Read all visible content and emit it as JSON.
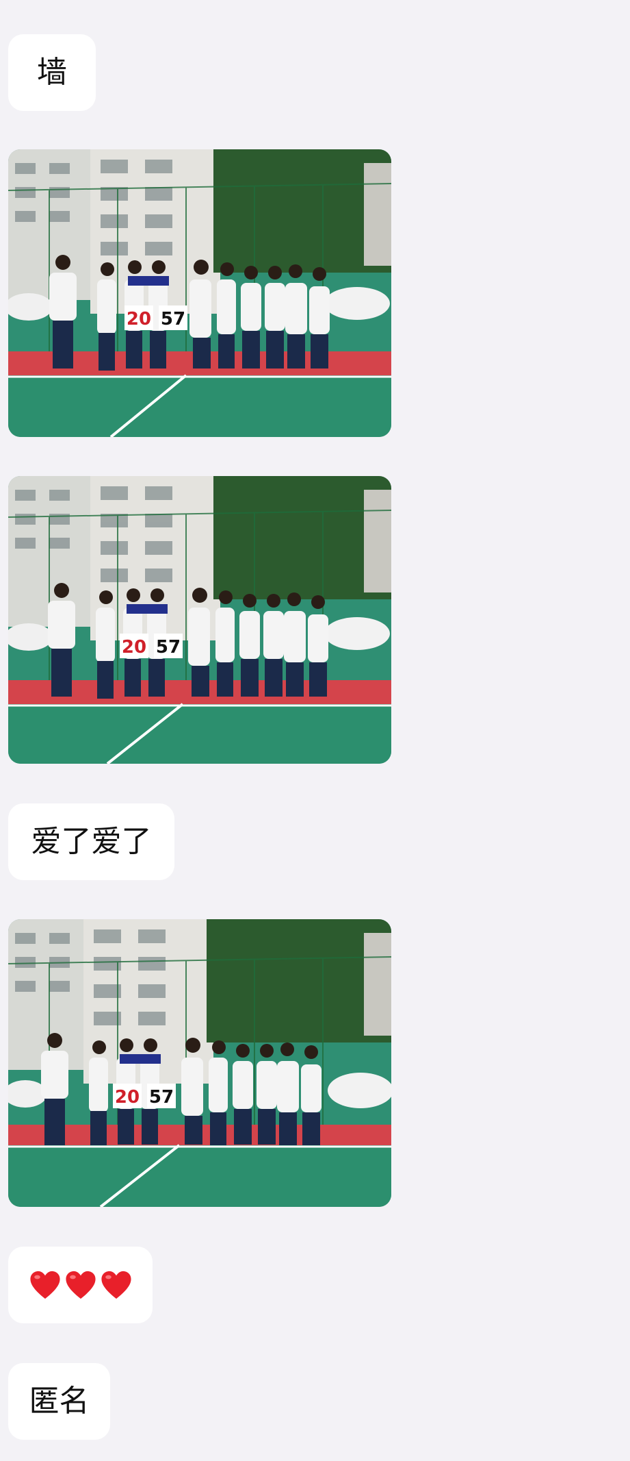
{
  "messages": [
    {
      "type": "text",
      "text": "墙"
    },
    {
      "type": "image",
      "alt": "",
      "scoreboard": {
        "home": "20",
        "away": "57"
      }
    },
    {
      "type": "image",
      "alt": "",
      "scoreboard": {
        "home": "20",
        "away": "57"
      }
    },
    {
      "type": "text",
      "text": "爱了爱了"
    },
    {
      "type": "image",
      "alt": "",
      "scoreboard": {
        "home": "20",
        "away": "57"
      }
    },
    {
      "type": "emoji",
      "icons": [
        "red-heart-icon",
        "red-heart-icon",
        "red-heart-icon"
      ]
    },
    {
      "type": "text",
      "text": "匿名"
    }
  ],
  "colors": {
    "background": "#f3f2f6",
    "bubble": "#ffffff",
    "heart": "#e8202a"
  }
}
